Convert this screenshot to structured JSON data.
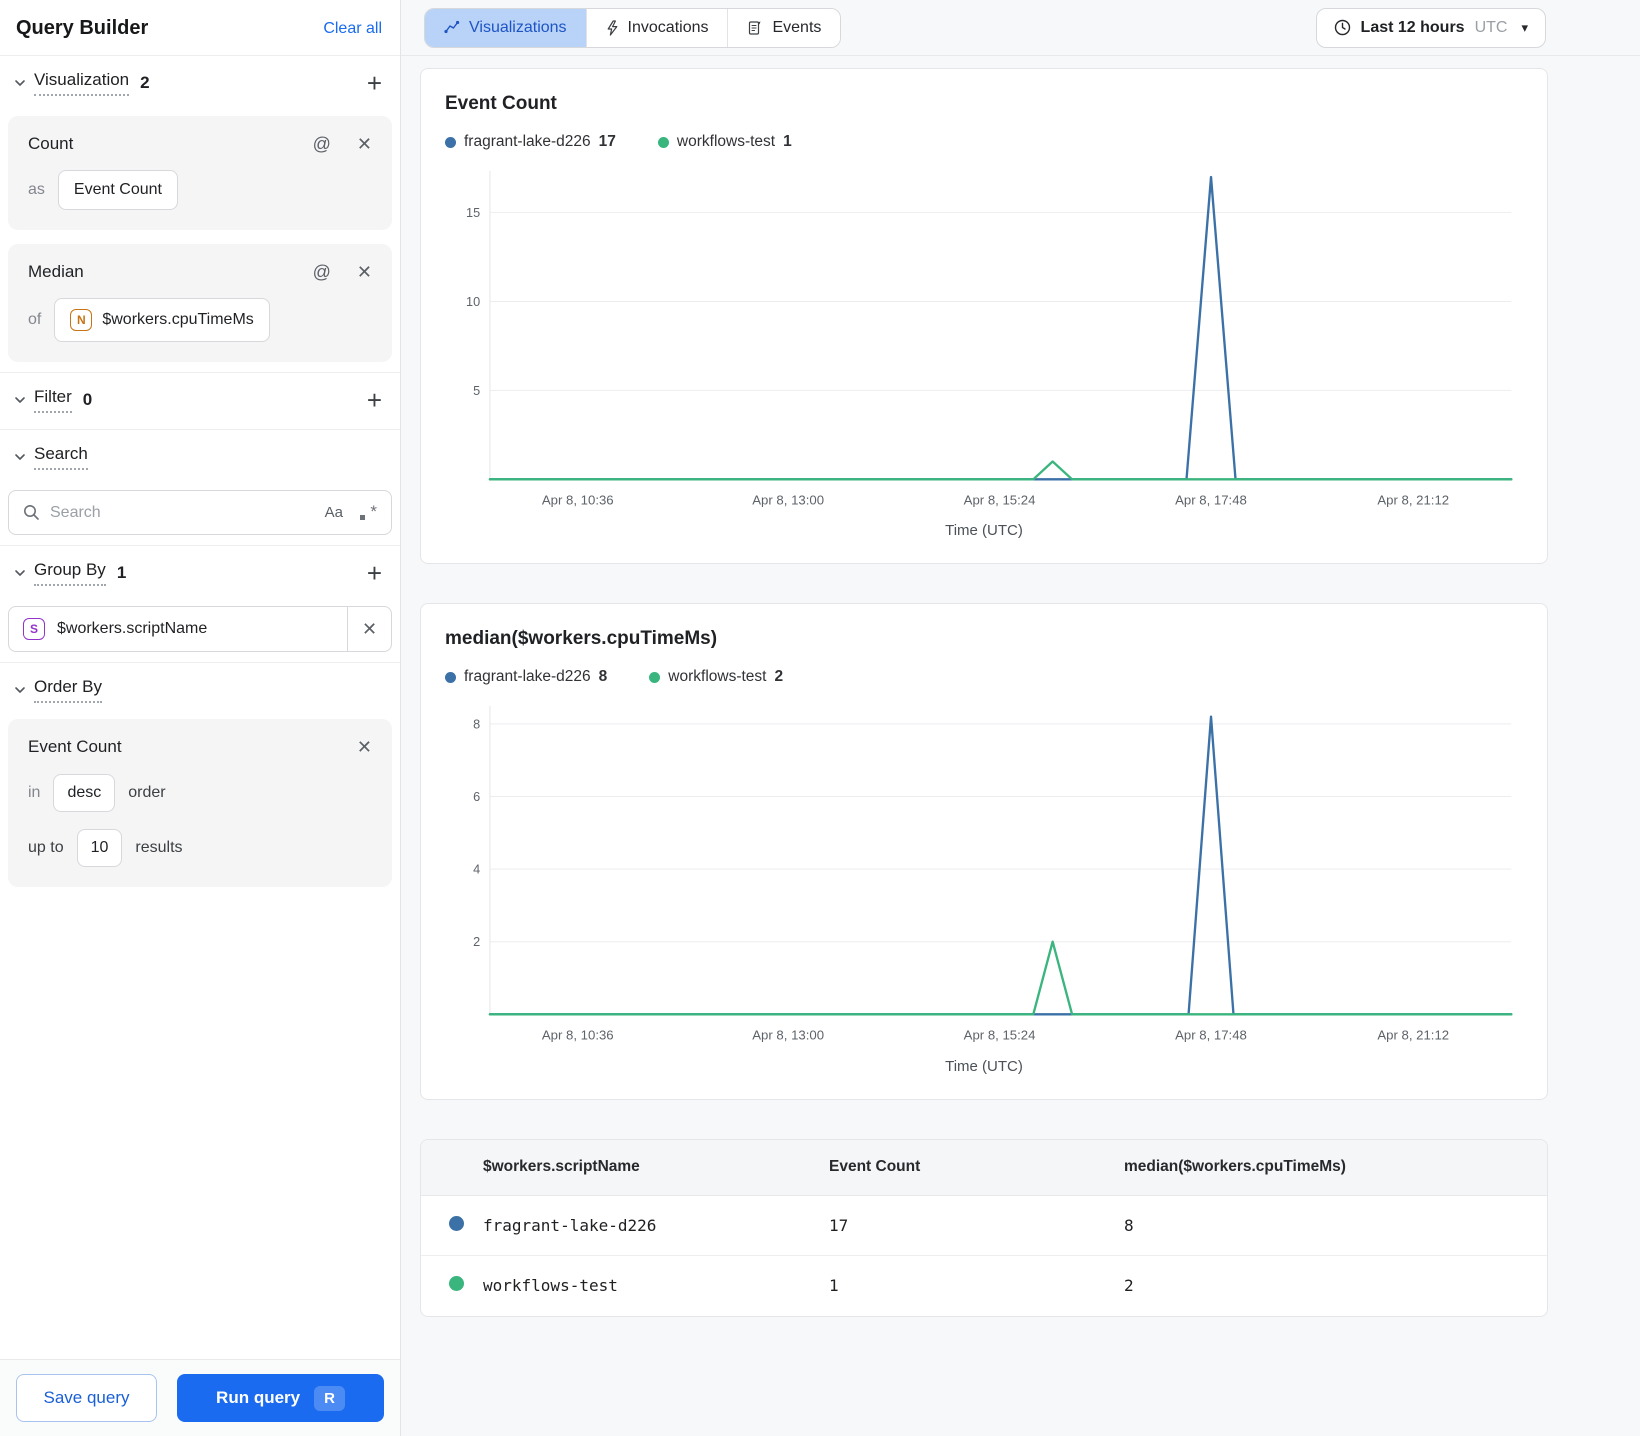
{
  "icons": {
    "at": "@",
    "close": "✕",
    "plus": "+",
    "match_case": "Aa",
    "regex_star": "*",
    "caret": "▾"
  },
  "colors": {
    "accent_blue": "#1a6bf0",
    "tab_selected_bg": "#b9d2f8",
    "series_blue": "#3b71a6",
    "series_green": "#3ab57e"
  },
  "sidebar": {
    "title": "Query Builder",
    "clear_all": "Clear all",
    "visualization": {
      "label": "Visualization",
      "count": "2",
      "cards": [
        {
          "title": "Count",
          "prefix": "as",
          "value": "Event Count",
          "badge": null
        },
        {
          "title": "Median",
          "prefix": "of",
          "value": "$workers.cpuTimeMs",
          "badge": "N"
        }
      ]
    },
    "filter": {
      "label": "Filter",
      "count": "0"
    },
    "search": {
      "label": "Search",
      "placeholder": "Search",
      "match_case": "Aa"
    },
    "group_by": {
      "label": "Group By",
      "count": "1",
      "item": {
        "badge": "S",
        "value": "$workers.scriptName"
      }
    },
    "order_by": {
      "label": "Order By",
      "card": {
        "title": "Event Count",
        "in_label": "in",
        "order_value": "desc",
        "order_suffix": "order",
        "upto_label": "up to",
        "limit_value": "10",
        "results_suffix": "results"
      }
    },
    "footer": {
      "save": "Save query",
      "run": "Run query",
      "run_kbd": "R"
    }
  },
  "header": {
    "tabs": [
      {
        "label": "Visualizations",
        "icon": "chart-icon",
        "active": true
      },
      {
        "label": "Invocations",
        "icon": "lightning-icon",
        "active": false
      },
      {
        "label": "Events",
        "icon": "events-icon",
        "active": false
      }
    ],
    "time_range": {
      "label": "Last 12 hours",
      "zone": "UTC"
    }
  },
  "chart_data": [
    {
      "type": "line",
      "title": "Event Count",
      "xlabel": "Time (UTC)",
      "legend": [
        {
          "name": "fragrant-lake-d226",
          "total": "17",
          "color": "#3b71a6"
        },
        {
          "name": "workflows-test",
          "total": "1",
          "color": "#3ab57e"
        }
      ],
      "y_ticks": [
        5,
        10,
        15
      ],
      "ymax": 17.35,
      "x_ticks": [
        {
          "pos": 0.086,
          "label": "Apr 8, 10:36"
        },
        {
          "pos": 0.292,
          "label": "Apr 8, 13:00"
        },
        {
          "pos": 0.499,
          "label": "Apr 8, 15:24"
        },
        {
          "pos": 0.706,
          "label": "Apr 8, 17:48"
        },
        {
          "pos": 0.904,
          "label": "Apr 8, 21:12"
        }
      ],
      "series": [
        {
          "name": "fragrant-lake-d226",
          "color": "#3b71a6",
          "points": [
            [
              0,
              0
            ],
            [
              0.682,
              0
            ],
            [
              0.706,
              17
            ],
            [
              0.73,
              0
            ],
            [
              1,
              0
            ]
          ]
        },
        {
          "name": "workflows-test",
          "color": "#3ab57e",
          "points": [
            [
              0,
              0
            ],
            [
              0.532,
              0
            ],
            [
              0.551,
              1
            ],
            [
              0.57,
              0
            ],
            [
              1,
              0
            ]
          ]
        }
      ]
    },
    {
      "type": "line",
      "title": "median($workers.cpuTimeMs)",
      "xlabel": "Time (UTC)",
      "legend": [
        {
          "name": "fragrant-lake-d226",
          "total": "8",
          "color": "#3b71a6"
        },
        {
          "name": "workflows-test",
          "total": "2",
          "color": "#3ab57e"
        }
      ],
      "y_ticks": [
        2,
        4,
        6,
        8
      ],
      "ymax": 8.5,
      "x_ticks": [
        {
          "pos": 0.086,
          "label": "Apr 8, 10:36"
        },
        {
          "pos": 0.292,
          "label": "Apr 8, 13:00"
        },
        {
          "pos": 0.499,
          "label": "Apr 8, 15:24"
        },
        {
          "pos": 0.706,
          "label": "Apr 8, 17:48"
        },
        {
          "pos": 0.904,
          "label": "Apr 8, 21:12"
        }
      ],
      "series": [
        {
          "name": "fragrant-lake-d226",
          "color": "#3b71a6",
          "points": [
            [
              0,
              0
            ],
            [
              0.684,
              0
            ],
            [
              0.706,
              8.2
            ],
            [
              0.728,
              0
            ],
            [
              1,
              0
            ]
          ]
        },
        {
          "name": "workflows-test",
          "color": "#3ab57e",
          "points": [
            [
              0,
              0
            ],
            [
              0.532,
              0
            ],
            [
              0.551,
              2
            ],
            [
              0.57,
              0
            ],
            [
              1,
              0
            ]
          ]
        }
      ]
    }
  ],
  "table": {
    "columns": [
      "$workers.scriptName",
      "Event Count",
      "median($workers.cpuTimeMs)"
    ],
    "rows": [
      {
        "color": "#3b71a6",
        "name": "fragrant-lake-d226",
        "event_count": "17",
        "median": "8"
      },
      {
        "color": "#3ab57e",
        "name": "workflows-test",
        "event_count": "1",
        "median": "2"
      }
    ]
  }
}
